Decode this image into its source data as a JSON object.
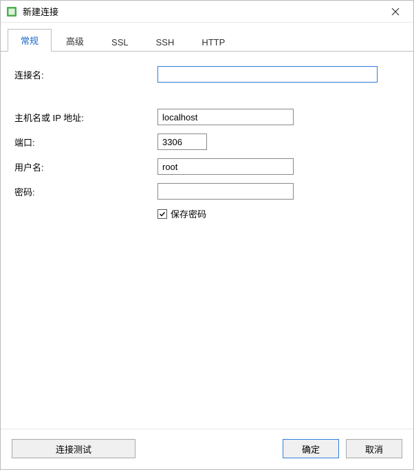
{
  "window": {
    "title": "新建连接"
  },
  "tabs": {
    "general": "常规",
    "advanced": "高级",
    "ssl": "SSL",
    "ssh": "SSH",
    "http": "HTTP"
  },
  "form": {
    "connection_name_label": "连接名:",
    "connection_name_value": "",
    "host_label": "主机名或 IP 地址:",
    "host_value": "localhost",
    "port_label": "端口:",
    "port_value": "3306",
    "username_label": "用户名:",
    "username_value": "root",
    "password_label": "密码:",
    "password_value": "",
    "save_password_label": "保存密码",
    "save_password_checked": true
  },
  "buttons": {
    "test": "连接测试",
    "ok": "确定",
    "cancel": "取消"
  }
}
